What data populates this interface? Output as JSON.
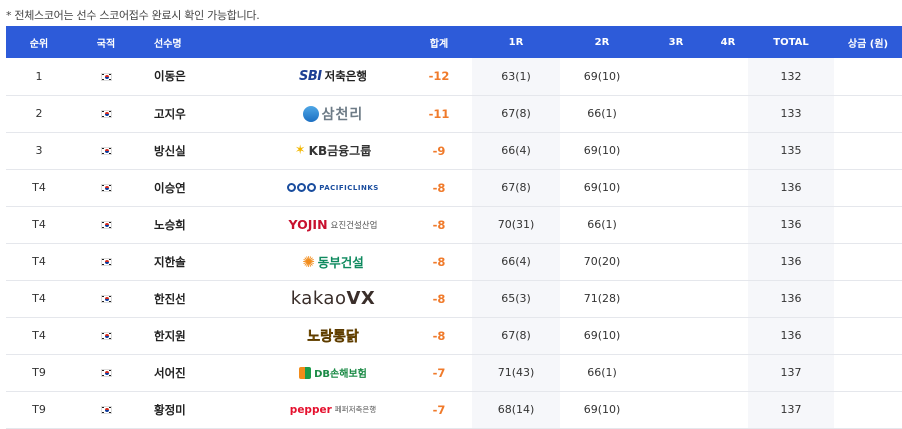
{
  "note": "* 전체스코어는 선수 스코어접수 완료시 확인 가능합니다.",
  "columns": {
    "rank": "순위",
    "nation": "국적",
    "player": "선수명",
    "total": "합계",
    "r1": "1R",
    "r2": "2R",
    "r3": "3R",
    "r4": "4R",
    "sum": "TOTAL",
    "prize": "상금 (원)"
  },
  "rows": [
    {
      "rank": "1",
      "name": "이동은",
      "sponsor": "sbi",
      "sponsor_text": "저축은행",
      "sponsor_mark": "SBI",
      "total": "-12",
      "r1": "63(1)",
      "r2": "69(10)",
      "r3": "",
      "r4": "",
      "sum": "132",
      "prize": ""
    },
    {
      "rank": "2",
      "name": "고지우",
      "sponsor": "sam",
      "sponsor_text": "삼천리",
      "sponsor_mark": "",
      "total": "-11",
      "r1": "67(8)",
      "r2": "66(1)",
      "r3": "",
      "r4": "",
      "sum": "133",
      "prize": ""
    },
    {
      "rank": "3",
      "name": "방신실",
      "sponsor": "kb",
      "sponsor_text": "KB금융그룹",
      "sponsor_mark": "",
      "total": "-9",
      "r1": "66(4)",
      "r2": "69(10)",
      "r3": "",
      "r4": "",
      "sum": "135",
      "prize": ""
    },
    {
      "rank": "T4",
      "name": "이승연",
      "sponsor": "pac",
      "sponsor_text": "PACIFICLINKS",
      "sponsor_mark": "",
      "total": "-8",
      "r1": "67(8)",
      "r2": "69(10)",
      "r3": "",
      "r4": "",
      "sum": "136",
      "prize": ""
    },
    {
      "rank": "T4",
      "name": "노승희",
      "sponsor": "yojin",
      "sponsor_text": "요진건설산업",
      "sponsor_mark": "YOJIN",
      "total": "-8",
      "r1": "70(31)",
      "r2": "66(1)",
      "r3": "",
      "r4": "",
      "sum": "136",
      "prize": ""
    },
    {
      "rank": "T4",
      "name": "지한솔",
      "sponsor": "dongbu",
      "sponsor_text": "동부건설",
      "sponsor_mark": "",
      "total": "-8",
      "r1": "66(4)",
      "r2": "70(20)",
      "r3": "",
      "r4": "",
      "sum": "136",
      "prize": ""
    },
    {
      "rank": "T4",
      "name": "한진선",
      "sponsor": "kakao",
      "sponsor_text": "kakao",
      "sponsor_mark": "VX",
      "total": "-8",
      "r1": "65(3)",
      "r2": "71(28)",
      "r3": "",
      "r4": "",
      "sum": "136",
      "prize": ""
    },
    {
      "rank": "T4",
      "name": "한지원",
      "sponsor": "nojang",
      "sponsor_text": "노랑통닭",
      "sponsor_mark": "",
      "total": "-8",
      "r1": "67(8)",
      "r2": "69(10)",
      "r3": "",
      "r4": "",
      "sum": "136",
      "prize": ""
    },
    {
      "rank": "T9",
      "name": "서어진",
      "sponsor": "db",
      "sponsor_text": "DB손해보험",
      "sponsor_mark": "",
      "total": "-7",
      "r1": "71(43)",
      "r2": "66(1)",
      "r3": "",
      "r4": "",
      "sum": "137",
      "prize": ""
    },
    {
      "rank": "T9",
      "name": "황정미",
      "sponsor": "pepper",
      "sponsor_text": "페퍼저축은행",
      "sponsor_mark": "pepper",
      "total": "-7",
      "r1": "68(14)",
      "r2": "69(10)",
      "r3": "",
      "r4": "",
      "sum": "137",
      "prize": ""
    }
  ],
  "colors": {
    "header_bg": "#2d5bd9",
    "total_text": "#f07a2a",
    "stripe": "#f6f7fa"
  },
  "icons": {
    "flag": "korea-flag-icon"
  }
}
